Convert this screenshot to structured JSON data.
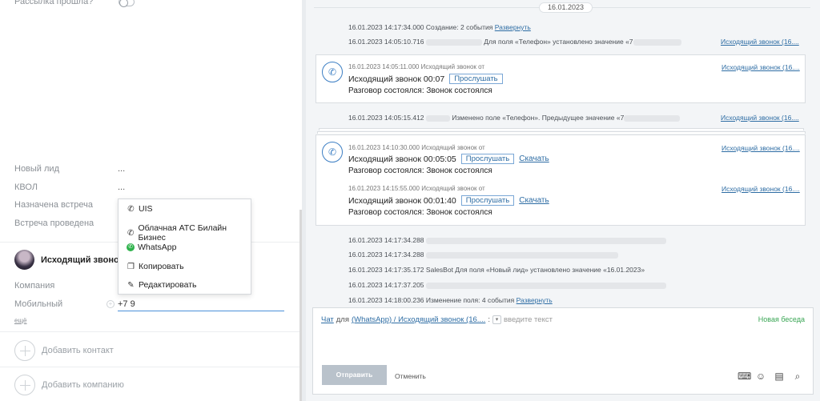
{
  "left": {
    "rassylka_label": "Рассылка прошла?",
    "fields": [
      {
        "label": "Новый лид",
        "value": "..."
      },
      {
        "label": "КВОЛ",
        "value": "..."
      },
      {
        "label": "Назначена встреча",
        "value": ""
      },
      {
        "label": "Встреча проведена",
        "value": ""
      }
    ],
    "contact_name": "Исходящий звонок",
    "company_label": "Компания",
    "mobile_label": "Мобильный",
    "mobile_value": "+7 9",
    "more_link": "ещё",
    "add_contact": "Добавить контакт",
    "add_company": "Добавить компанию"
  },
  "menu": {
    "items": [
      {
        "icon": "phone-icon",
        "label": "UIS"
      },
      {
        "icon": "phone-icon",
        "label": "Облачная АТС Билайн Бизнес"
      },
      {
        "icon": "whatsapp-icon",
        "label": "WhatsApp"
      },
      {
        "icon": "copy-icon",
        "label": "Копировать"
      },
      {
        "icon": "pencil-icon",
        "label": "Редактировать"
      }
    ]
  },
  "feed": {
    "date": "16.01.2023",
    "line1_time": "16.01.2023 14:17:34.000",
    "line1_text": "Создание: 2 события",
    "line1_link": "Развернуть",
    "line2_time": "16.01.2023 14:05:10.716",
    "line2_text": "Для поля «Телефон» установлено значение «7",
    "line2_rlink": "Исходящий звонок (16....",
    "card1": {
      "meta": "16.01.2023 14:05:11.000 Исходящий звонок от",
      "title": "Исходящий звонок 00:07",
      "listen": "Прослушать",
      "sub": "Разговор состоялся: Звонок состоялся",
      "rlink": "Исходящий звонок (16...."
    },
    "line3_time": "16.01.2023 14:05:15.412",
    "line3_text": "Изменено поле «Телефон». Предыдущее значение «7",
    "line3_rlink": "Исходящий звонок (16....",
    "card2": {
      "meta": "16.01.2023 14:10:30.000 Исходящий звонок от",
      "title": "Исходящий звонок 00:05:05",
      "listen": "Прослушать",
      "download": "Скачать",
      "sub": "Разговор состоялся: Звонок состоялся",
      "rlink": "Исходящий звонок (16....",
      "meta2": "16.01.2023 14:15:55.000 Исходящий звонок от",
      "title2": "Исходящий звонок 00:01:40",
      "listen2": "Прослушать",
      "download2": "Скачать",
      "sub2": "Разговор состоялся: Звонок состоялся",
      "rlink2": "Исходящий звонок (16...."
    },
    "tail": [
      {
        "time": "16.01.2023 14:17:34.288",
        "text": ""
      },
      {
        "time": "16.01.2023 14:17:34.288",
        "text": ""
      },
      {
        "time": "16.01.2023 14:17:35.172",
        "text": "SalesBot Для поля «Новый лид» установлено значение «16.01.2023»"
      },
      {
        "time": "16.01.2023 14:17:37.205",
        "text": ""
      },
      {
        "time": "16.01.2023 14:18:00.236",
        "text": "Изменение поля: 4 события",
        "link": "Развернуть"
      }
    ]
  },
  "composer": {
    "chat_link": "Чат",
    "for_text": "для",
    "target_link": "(WhatsApp) / Исходящий звонок (16....",
    "colon": ":",
    "placeholder": "введите текст",
    "new_talk": "Новая беседа",
    "send": "Отправить",
    "cancel": "Отменить"
  }
}
